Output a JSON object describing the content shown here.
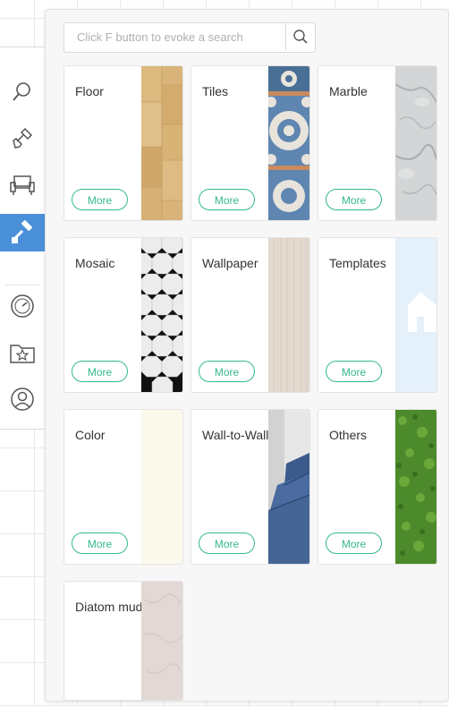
{
  "sidebar": {
    "tools": [
      {
        "name": "search-tool",
        "icon": "magnifier-icon"
      },
      {
        "name": "build-tool",
        "icon": "shovel-icon"
      },
      {
        "name": "furniture-tool",
        "icon": "armchair-icon"
      },
      {
        "name": "paint-tool",
        "icon": "paint-roller-icon",
        "active": true
      },
      {
        "name": "measure-tool",
        "icon": "gauge-icon"
      },
      {
        "name": "favorites-tool",
        "icon": "star-folder-icon"
      },
      {
        "name": "account-tool",
        "icon": "user-icon"
      }
    ],
    "active_color": "#4a90d9"
  },
  "search": {
    "placeholder": "Click F button to evoke a search"
  },
  "more_label": "More",
  "accent_color": "#35b98a",
  "categories": [
    {
      "title": "Floor",
      "swatch": "wood"
    },
    {
      "title": "Tiles",
      "swatch": "patterned-tiles"
    },
    {
      "title": "Marble",
      "swatch": "grey-marble"
    },
    {
      "title": "Mosaic",
      "swatch": "black-white-octagon"
    },
    {
      "title": "Wallpaper",
      "swatch": "beige-texture"
    },
    {
      "title": "Templates",
      "swatch": "light-blue-house"
    },
    {
      "title": "Color",
      "swatch": "cream"
    },
    {
      "title": "Wall-to-Wall Ca...",
      "swatch": "blue-carpet-stairs"
    },
    {
      "title": "Others",
      "swatch": "grass"
    },
    {
      "title": "Diatom mud",
      "swatch": "pink-plaster"
    }
  ]
}
